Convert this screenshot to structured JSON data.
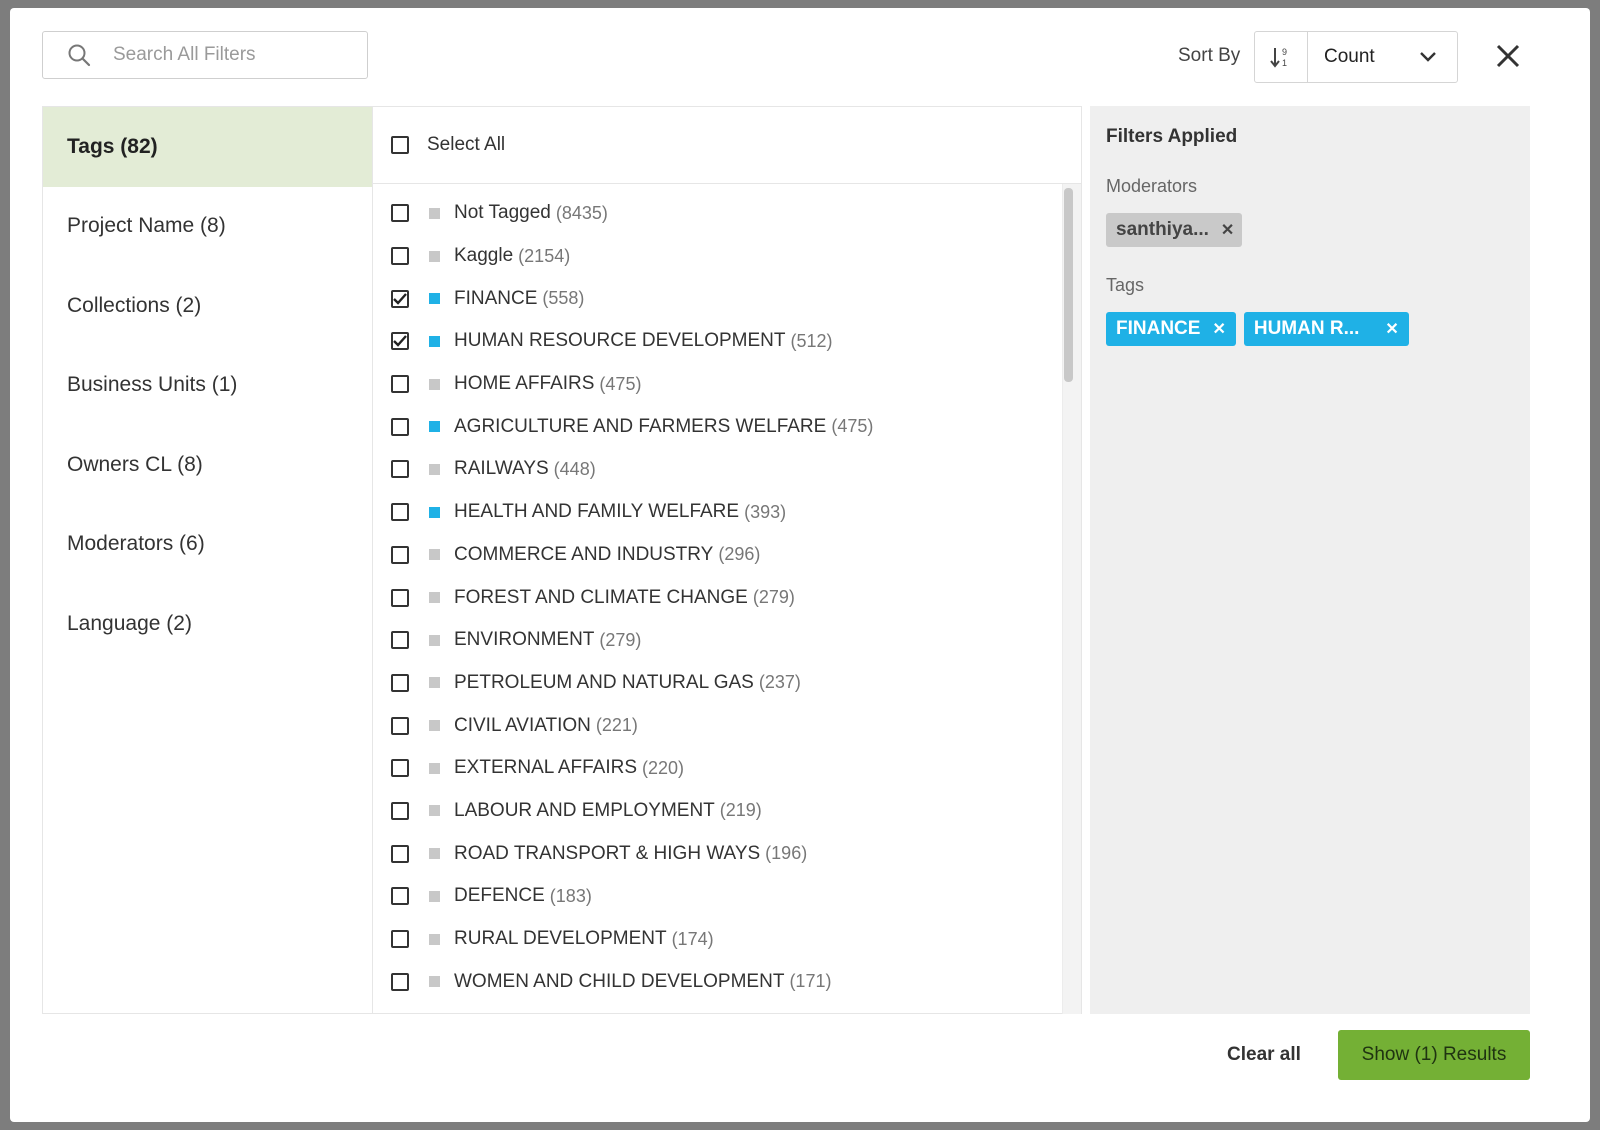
{
  "search": {
    "placeholder": "Search All Filters"
  },
  "sort": {
    "label": "Sort By",
    "selected": "Count"
  },
  "categories": [
    {
      "label": "Tags (82)"
    },
    {
      "label": "Project Name (8)"
    },
    {
      "label": "Collections (2)"
    },
    {
      "label": "Business Units (1)"
    },
    {
      "label": "Owners CL (8)"
    },
    {
      "label": "Moderators (6)"
    },
    {
      "label": "Language (2)"
    }
  ],
  "list": {
    "select_all": "Select All",
    "items": [
      {
        "label": "Not Tagged",
        "count": "(8435)",
        "checked": false,
        "swatch": "#c8c8c8"
      },
      {
        "label": "Kaggle",
        "count": "(2154)",
        "checked": false,
        "swatch": "#c8c8c8"
      },
      {
        "label": "FINANCE",
        "count": "(558)",
        "checked": true,
        "swatch": "#1fb1e6"
      },
      {
        "label": "HUMAN RESOURCE DEVELOPMENT",
        "count": "(512)",
        "checked": true,
        "swatch": "#1fb1e6"
      },
      {
        "label": "HOME AFFAIRS",
        "count": "(475)",
        "checked": false,
        "swatch": "#c8c8c8"
      },
      {
        "label": "AGRICULTURE AND FARMERS WELFARE",
        "count": "(475)",
        "checked": false,
        "swatch": "#1fb1e6"
      },
      {
        "label": "RAILWAYS",
        "count": "(448)",
        "checked": false,
        "swatch": "#c8c8c8"
      },
      {
        "label": "HEALTH AND FAMILY WELFARE",
        "count": "(393)",
        "checked": false,
        "swatch": "#1fb1e6"
      },
      {
        "label": "COMMERCE AND INDUSTRY",
        "count": "(296)",
        "checked": false,
        "swatch": "#c8c8c8"
      },
      {
        "label": "FOREST AND CLIMATE CHANGE",
        "count": "(279)",
        "checked": false,
        "swatch": "#c8c8c8"
      },
      {
        "label": "ENVIRONMENT",
        "count": "(279)",
        "checked": false,
        "swatch": "#c8c8c8"
      },
      {
        "label": "PETROLEUM AND NATURAL GAS",
        "count": "(237)",
        "checked": false,
        "swatch": "#c8c8c8"
      },
      {
        "label": "CIVIL AVIATION",
        "count": "(221)",
        "checked": false,
        "swatch": "#c8c8c8"
      },
      {
        "label": "EXTERNAL AFFAIRS",
        "count": "(220)",
        "checked": false,
        "swatch": "#c8c8c8"
      },
      {
        "label": "LABOUR AND EMPLOYMENT",
        "count": "(219)",
        "checked": false,
        "swatch": "#c8c8c8"
      },
      {
        "label": "ROAD TRANSPORT & HIGH WAYS",
        "count": "(196)",
        "checked": false,
        "swatch": "#c8c8c8"
      },
      {
        "label": "DEFENCE",
        "count": "(183)",
        "checked": false,
        "swatch": "#c8c8c8"
      },
      {
        "label": "RURAL DEVELOPMENT",
        "count": "(174)",
        "checked": false,
        "swatch": "#c8c8c8"
      },
      {
        "label": "WOMEN AND CHILD DEVELOPMENT",
        "count": "(171)",
        "checked": false,
        "swatch": "#c8c8c8"
      }
    ]
  },
  "applied": {
    "title": "Filters Applied",
    "moderators_label": "Moderators",
    "moderators": [
      "santhiya..."
    ],
    "tags_label": "Tags",
    "tags": [
      "FINANCE",
      "HUMAN R..."
    ]
  },
  "footer": {
    "clear_all": "Clear all",
    "show_results": "Show (1) Results"
  },
  "colors": {
    "accent_blue": "#1fb1e6",
    "button_green": "#74b035",
    "active_tab": "#e3ecd6"
  }
}
